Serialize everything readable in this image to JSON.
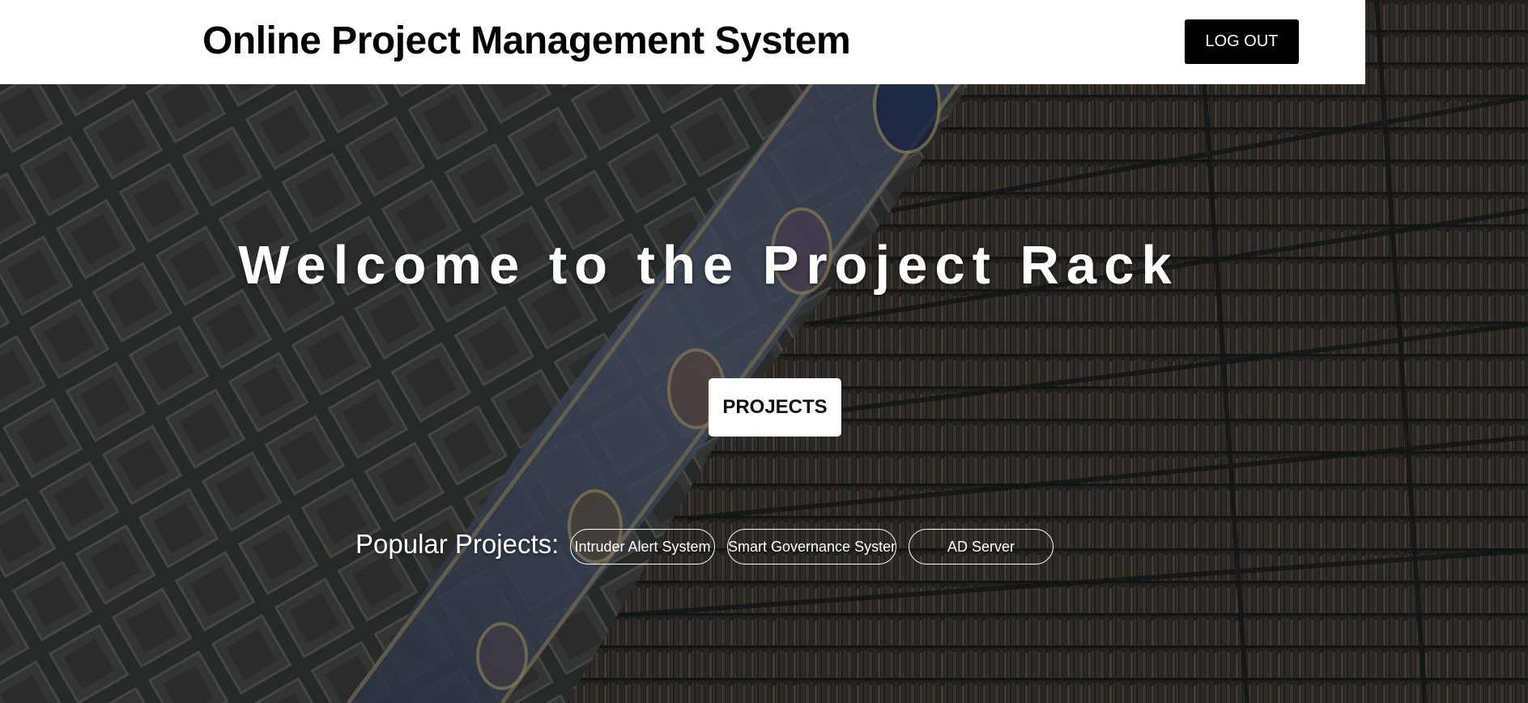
{
  "header": {
    "title": "Online Project Management System",
    "logout_label": "LOG OUT"
  },
  "hero": {
    "welcome_text": "Welcome to the Project Rack",
    "projects_button_label": "PROJECTS",
    "popular_label": "Popular Projects:",
    "popular_projects": [
      {
        "label": "Intruder Alert System"
      },
      {
        "label": "Smart Governance System"
      },
      {
        "label": "AD Server"
      }
    ]
  },
  "theme": {
    "header_bg": "#ffffff",
    "logout_bg": "#000000",
    "hero_text": "#ffffff",
    "background_image": "library-interior"
  }
}
